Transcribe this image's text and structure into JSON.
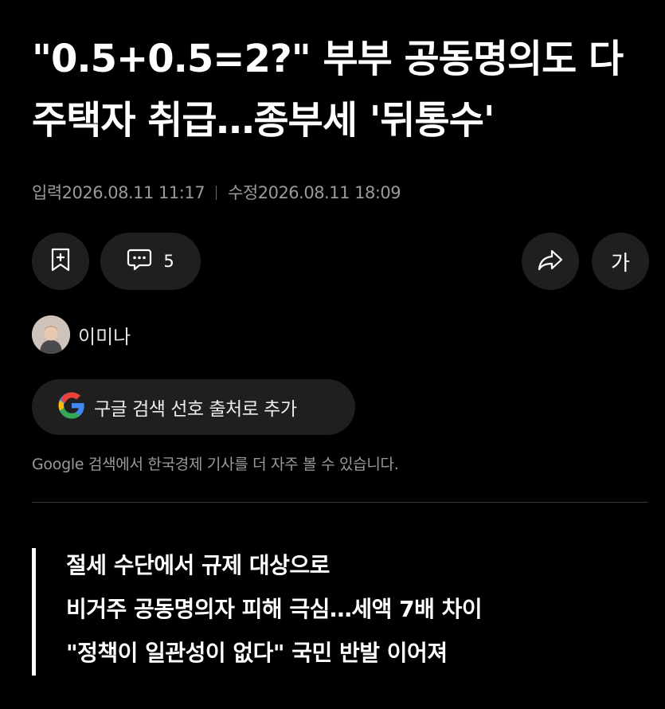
{
  "article": {
    "headline_line1": "\"0.5+0.5=2?\" 부부 공동명의도 다",
    "headline_line2": "주택자 취급…종부세 '뒤통수'",
    "published": "입력2026.08.11 11:17",
    "modified": "수정2026.08.11 18:09"
  },
  "actions": {
    "bookmark_icon": "bookmark-plus-icon",
    "comment_icon": "comment-icon",
    "comment_count": "5",
    "share_icon": "share-icon",
    "font_size_label": "가"
  },
  "author": {
    "name": "이미나"
  },
  "google": {
    "button_label": "구글 검색 선호 출처로 추가",
    "note": "Google 검색에서 한국경제 기사를 더 자주 볼 수 있습니다.",
    "logo_colors": [
      "#4285F4",
      "#EA4335",
      "#FBBC05",
      "#34A853"
    ]
  },
  "summary": {
    "lines": [
      "절세 수단에서 규제 대상으로",
      "비거주 공동명의자 피해 극심…세액 7배 차이",
      "\"정책이 일관성이 없다\" 국민 반발 이어져"
    ]
  },
  "colors": {
    "background": "#000000",
    "button_bg": "#1f1f1f",
    "muted_text": "#9a9a9a"
  }
}
